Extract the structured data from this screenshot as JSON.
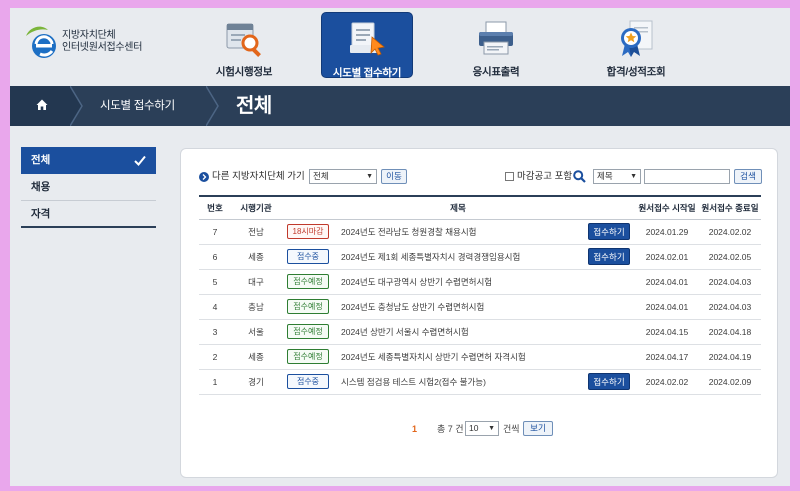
{
  "logo": {
    "line1": "지방자치단체",
    "line2": "인터넷원서접수센터"
  },
  "nav": [
    {
      "label": "시험시행정보",
      "icon": "magnifier-document-icon",
      "active": false
    },
    {
      "label": "시도별 접수하기",
      "icon": "document-pointer-icon",
      "active": true
    },
    {
      "label": "응시표출력",
      "icon": "printer-icon",
      "active": false
    },
    {
      "label": "합격/성적조회",
      "icon": "award-certificate-icon",
      "active": false
    }
  ],
  "breadcrumb": {
    "home_icon": "home-icon",
    "item": "시도별 접수하기"
  },
  "page_title": "전체",
  "sidebar": {
    "items": [
      {
        "label": "전체",
        "active": true
      },
      {
        "label": "채용",
        "active": false
      },
      {
        "label": "자격",
        "active": false
      }
    ]
  },
  "toolbar": {
    "region_label": "다른 지방자치단체 가기",
    "region_value": "전체",
    "move_button": "이동",
    "include_closed_label": "마감공고 포함",
    "search_field_value": "제목",
    "search_button": "검색"
  },
  "table": {
    "headers": [
      "번호",
      "시행기관",
      "제목",
      "원서접수 시작일",
      "원서접수 종료일"
    ],
    "rows": [
      {
        "no": "7",
        "org": "전남",
        "status": "18시마감",
        "status_type": "closing",
        "title": "2024년도 전라남도 청원경찰 채용시험",
        "apply": "접수하기",
        "start": "2024.01.29",
        "end": "2024.02.02"
      },
      {
        "no": "6",
        "org": "세종",
        "status": "접수중",
        "status_type": "open",
        "title": "2024년도 제1회 세종특별자치시 경력경쟁임용시험",
        "apply": "접수하기",
        "start": "2024.02.01",
        "end": "2024.02.05"
      },
      {
        "no": "5",
        "org": "대구",
        "status": "접수예정",
        "status_type": "upcoming",
        "title": "2024년도 대구광역시 상반기 수렵면허시험",
        "apply": "",
        "start": "2024.04.01",
        "end": "2024.04.03"
      },
      {
        "no": "4",
        "org": "충남",
        "status": "접수예정",
        "status_type": "upcoming",
        "title": "2024년도 충청남도 상반기 수렵면허시험",
        "apply": "",
        "start": "2024.04.01",
        "end": "2024.04.03"
      },
      {
        "no": "3",
        "org": "서울",
        "status": "접수예정",
        "status_type": "upcoming",
        "title": "2024년 상반기 서울시 수렵면허시험",
        "apply": "",
        "start": "2024.04.15",
        "end": "2024.04.18"
      },
      {
        "no": "2",
        "org": "세종",
        "status": "접수예정",
        "status_type": "upcoming",
        "title": "2024년도 세종특별자치시 상반기 수렵면허 자격시험",
        "apply": "",
        "start": "2024.04.17",
        "end": "2024.04.19"
      },
      {
        "no": "1",
        "org": "경기",
        "status": "접수중",
        "status_type": "open",
        "title": "시스템 점검용 테스트 시험2(접수 불가능)",
        "apply": "접수하기",
        "start": "2024.02.02",
        "end": "2024.02.09"
      }
    ]
  },
  "pager": {
    "current_page": "1",
    "total_label": "총 7 건",
    "page_size": "10",
    "per_label": "건씩",
    "view_button": "보기"
  },
  "colors": {
    "primary": "#1b4f9e",
    "titlebar": "#2b3f58",
    "frame": "#e9a7ec"
  }
}
